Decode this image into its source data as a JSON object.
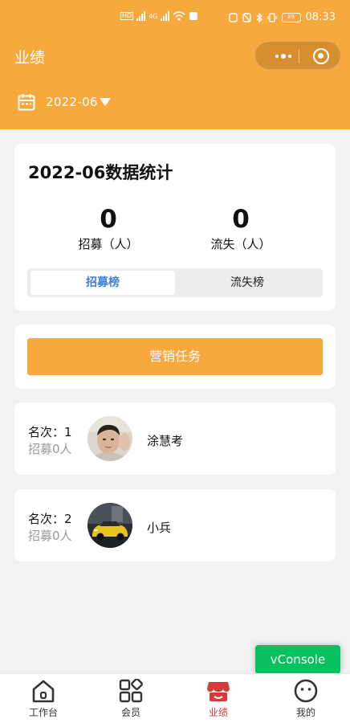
{
  "status_bar": {
    "network_left": "HD",
    "network_right": "4G",
    "battery": "89",
    "time": "08:33"
  },
  "header": {
    "title": "业绩",
    "month": "2022-06"
  },
  "stats": {
    "title": "2022-06数据统计",
    "recruit_value": "0",
    "recruit_label": "招募（人）",
    "loss_value": "0",
    "loss_label": "流失（人）",
    "tabs": [
      "招募榜",
      "流失榜"
    ],
    "active_tab": "招募榜"
  },
  "task_button_label": "营销任务",
  "rankings": [
    {
      "rank": "名次：1",
      "summary": "招募0人",
      "name": "涂慧考"
    },
    {
      "rank": "名次：2",
      "summary": "招募0人",
      "name": "小兵"
    }
  ],
  "vconsole_label": "vConsole",
  "tabbar": {
    "items": [
      {
        "label": "工作台",
        "icon": "house-icon"
      },
      {
        "label": "会员",
        "icon": "grid-icon"
      },
      {
        "label": "业绩",
        "icon": "shop-icon",
        "active": true
      },
      {
        "label": "我的",
        "icon": "smiley-icon"
      }
    ]
  },
  "colors": {
    "brand_orange": "#f8a93e",
    "active_tab_blue": "#3f7fd6",
    "active_nav_red": "#d83a3a",
    "vconsole_green": "#07c160"
  }
}
